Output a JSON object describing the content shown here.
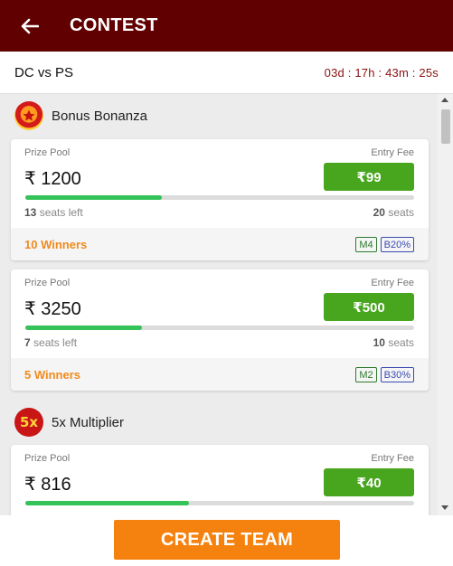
{
  "header": {
    "title": "CONTEST",
    "back_icon": "arrow-left-icon"
  },
  "match": {
    "title": "DC vs PS",
    "countdown": "03d : 17h : 43m : 25s"
  },
  "sections": [
    {
      "label": "Bonus Bonanza",
      "icon": "star-badge-icon",
      "cards": [
        {
          "prize_label": "Prize Pool",
          "entry_label": "Entry Fee",
          "prize": "₹ 1200",
          "fee": "₹99",
          "fill_fraction": 0.35,
          "seats_left_num": "13",
          "seats_left_text": " seats left",
          "seats_total_num": "20",
          "seats_total_text": " seats",
          "winners": "10 Winners",
          "tags": [
            "M4",
            "B20%"
          ]
        },
        {
          "prize_label": "Prize Pool",
          "entry_label": "Entry Fee",
          "prize": "₹ 3250",
          "fee": "₹500",
          "fill_fraction": 0.3,
          "seats_left_num": "7",
          "seats_left_text": " seats left",
          "seats_total_num": "10",
          "seats_total_text": " seats",
          "winners": "5 Winners",
          "tags": [
            "M2",
            "B30%"
          ]
        }
      ]
    },
    {
      "label": "5x Multiplier",
      "icon_text": "5x",
      "cards": [
        {
          "prize_label": "Prize Pool",
          "entry_label": "Entry Fee",
          "prize": "₹ 816",
          "fee": "₹40",
          "fill_fraction": 0.42
        }
      ]
    }
  ],
  "cta": {
    "label": "CREATE TEAM"
  },
  "colors": {
    "header_bg": "#610000",
    "fee_button": "#47a61d",
    "progress": "#35c258",
    "winners": "#f08a1c",
    "cta": "#f5820f",
    "countdown": "#8a1010"
  }
}
